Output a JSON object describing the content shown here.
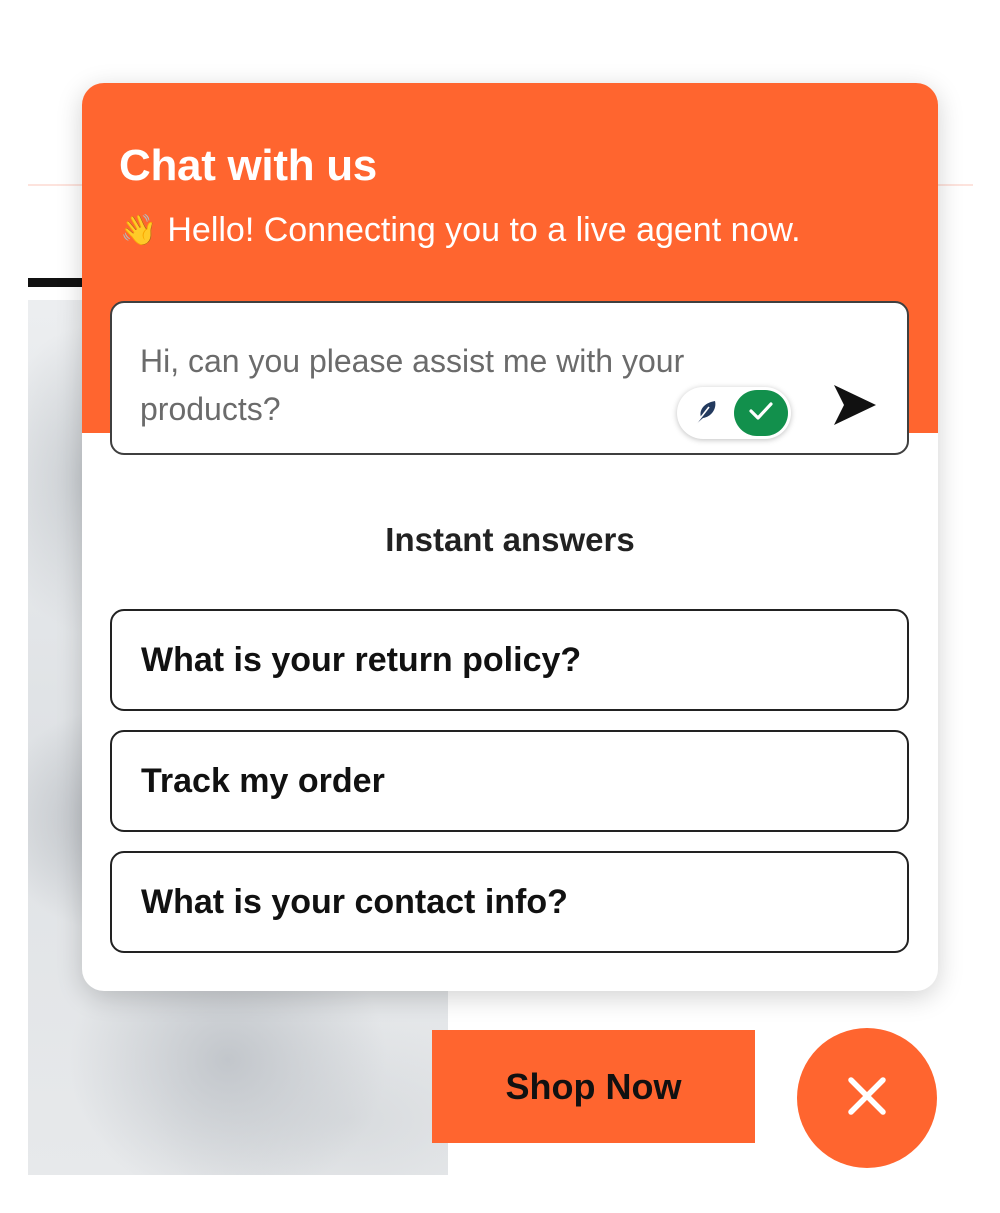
{
  "chat": {
    "title": "Chat with us",
    "greeting_icon": "👋",
    "greeting": "Hello! Connecting you to a live agent now.",
    "message": "Hi, can you please assist me with your products?"
  },
  "instant_answers": {
    "heading": "Instant answers",
    "items": [
      "What is your return policy?",
      "Track my order",
      "What is your contact info?"
    ]
  },
  "page": {
    "shop_now": "Shop Now"
  },
  "colors": {
    "accent": "#ff652f",
    "toggle_on": "#12904c"
  },
  "icons": {
    "greeting": "waving-hand-icon",
    "toggle_left": "feather-icon",
    "toggle_right": "check-icon",
    "send": "send-arrow-icon",
    "close": "close-icon"
  },
  "toggle_state": "on"
}
